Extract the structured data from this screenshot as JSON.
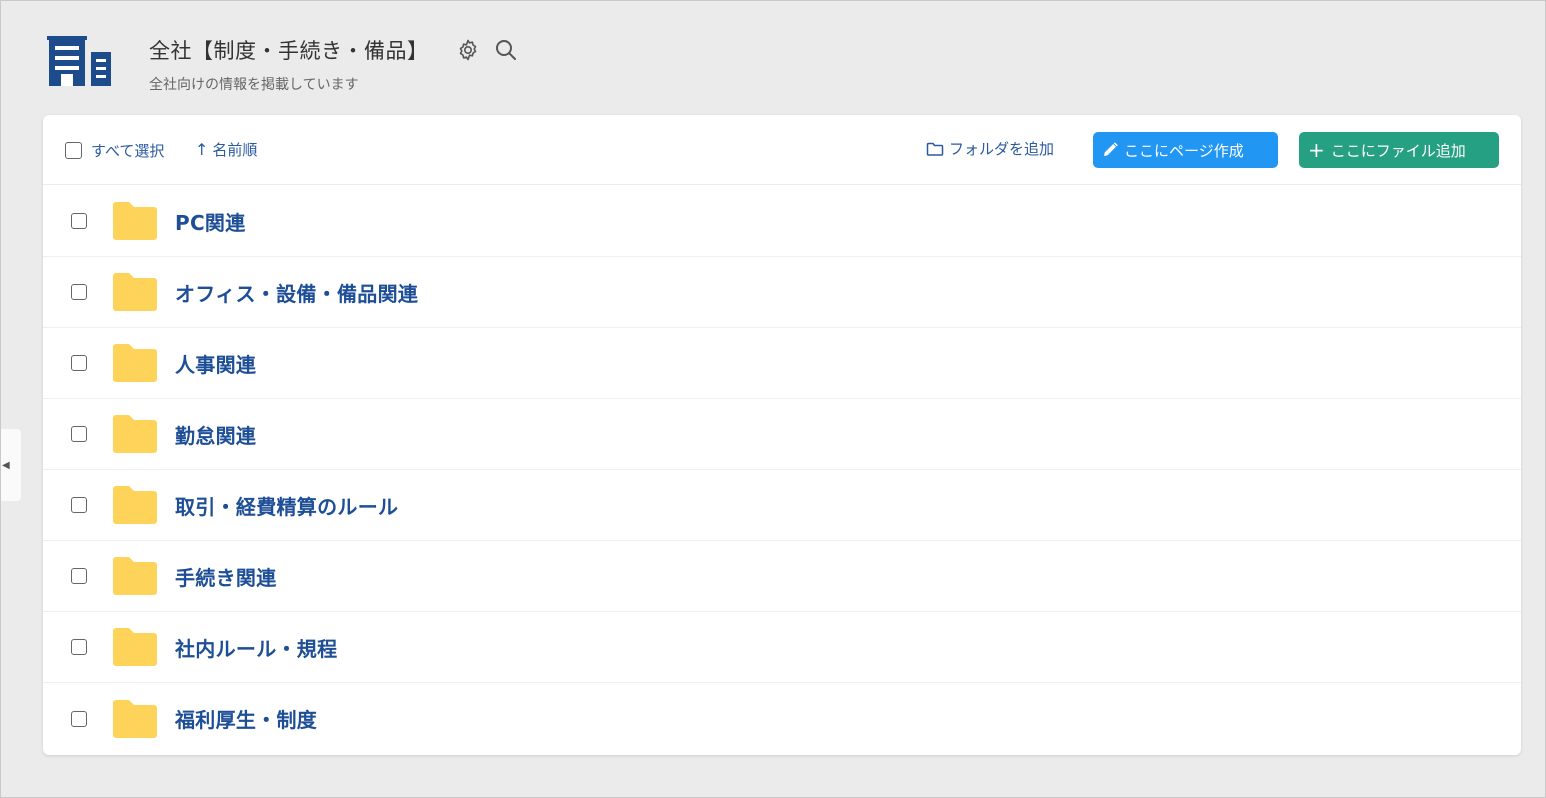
{
  "header": {
    "title": "全社【制度・手続き・備品】",
    "subtitle": "全社向けの情報を掲載しています",
    "space_icon": "building-icon",
    "settings_icon": "gear-icon",
    "search_icon": "search-icon"
  },
  "toolbar": {
    "select_all_label": "すべて選択",
    "sort_arrow": "↑",
    "sort_label": "名前順",
    "add_folder_label": "フォルダを追加",
    "create_page_label": "ここにページ作成",
    "upload_file_label": "ここにファイル追加",
    "upload_glyph": "+"
  },
  "folders": [
    {
      "name": "PC関連"
    },
    {
      "name": "オフィス・設備・備品関連"
    },
    {
      "name": "人事関連"
    },
    {
      "name": "勤怠関連"
    },
    {
      "name": "取引・経費精算のルール"
    },
    {
      "name": "手続き関連"
    },
    {
      "name": "社内ルール・規程"
    },
    {
      "name": "福利厚生・制度"
    }
  ],
  "sidebar": {
    "collapse_glyph": "◀"
  },
  "colors": {
    "link": "#2a5aa0",
    "folder_name": "#1e4f96",
    "folder_icon": "#fdd35a",
    "create_button": "#2196f3",
    "upload_button": "#26a082",
    "space_icon": "#1c4c8c"
  }
}
